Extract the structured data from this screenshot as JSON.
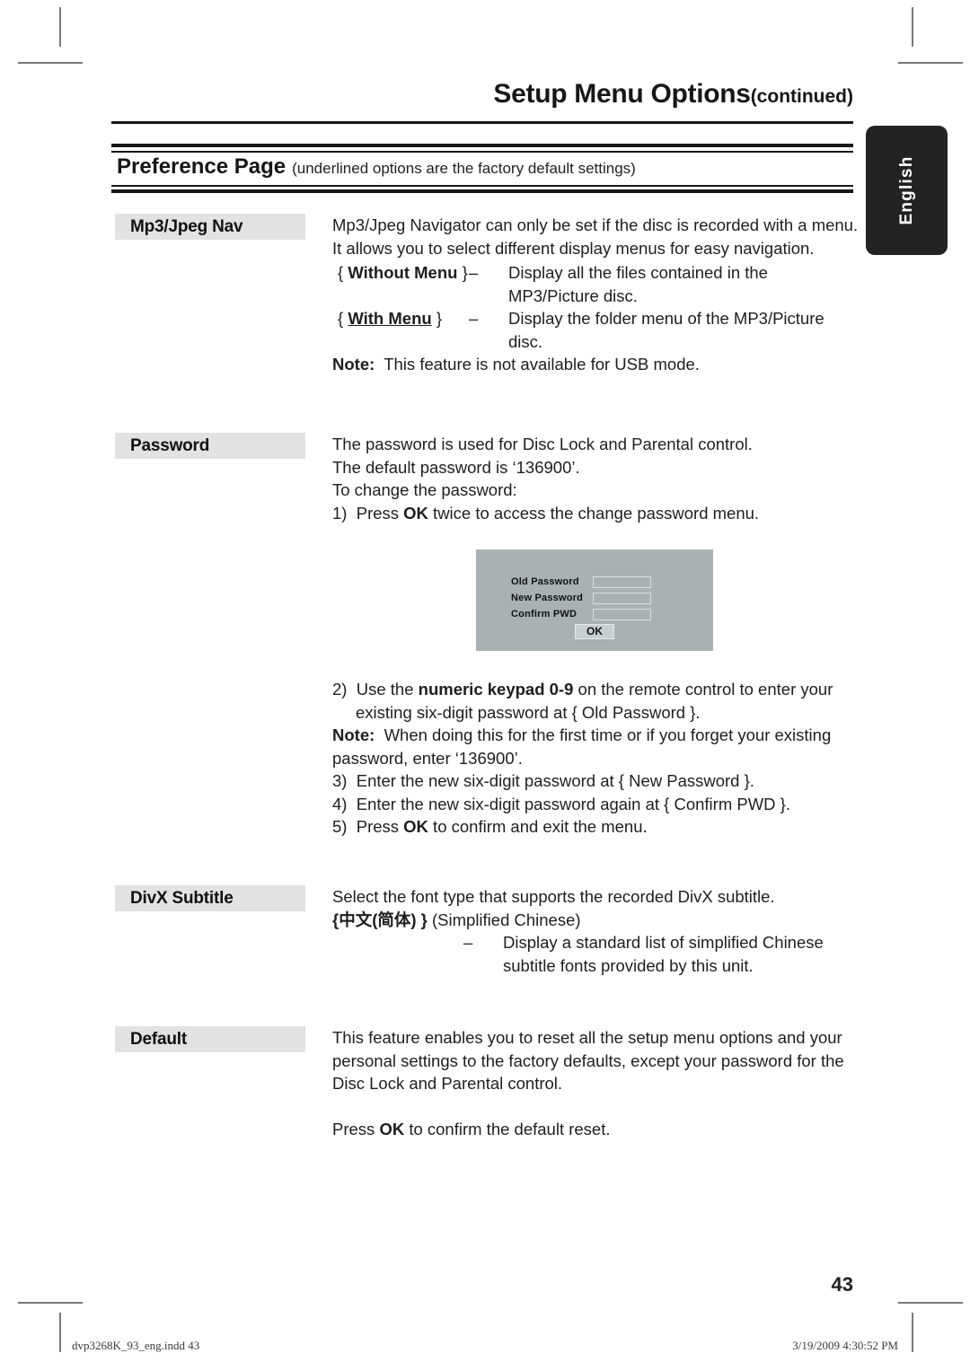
{
  "header": {
    "title": "Setup Menu Options",
    "continued": "(continued)"
  },
  "preference_bar": {
    "title": "Preference Page",
    "subtitle": "(underlined options are the factory default settings)"
  },
  "language_tab": {
    "label": "English"
  },
  "sections": {
    "mp3_jpeg_nav": {
      "label": "Mp3/Jpeg Nav",
      "intro": "Mp3/Jpeg Navigator can only be set if the disc is recorded with a menu. It allows you to select different display menus for easy navigation.",
      "options": [
        {
          "open_brace": "{",
          "name": "Without Menu",
          "close_brace": "}",
          "underlined": false,
          "dash": "–",
          "description": "Display all the files contained in the MP3/Picture disc."
        },
        {
          "open_brace": "{",
          "name": "With Menu",
          "close_brace": "}",
          "underlined": true,
          "dash": "–",
          "description": "Display the folder menu of the MP3/Picture disc."
        }
      ],
      "note_label": "Note:",
      "note_text": "This feature is not available for USB mode."
    },
    "password": {
      "label": "Password",
      "line1": "The password is used for Disc Lock and Parental control.",
      "line2": "The default password is ‘136900’.",
      "line3": "To change the password:",
      "step1_number": "1)",
      "step1_pre": "Press ",
      "step1_bold": "OK",
      "step1_post": " twice to access the change password menu.",
      "osd": {
        "old_password_label": "Old  Password",
        "new_password_label": "New Password",
        "confirm_pwd_label": "Confirm PWD",
        "old_password_value": "",
        "new_password_value": "",
        "confirm_pwd_value": "",
        "ok_button": "OK",
        "background_color": "#a8b2b4",
        "field_border_color": "#d8dde0"
      },
      "step2_number": "2)",
      "step2_pre": "Use the ",
      "step2_bold": "numeric keypad 0-9",
      "step2_post": " on the remote control to enter your existing six-digit password at { Old Password }.",
      "note_label": "Note:",
      "note_text": "When doing this for the first time or if you forget your existing password, enter ‘136900’.",
      "step3_number": "3)",
      "step3_text": "Enter the new six-digit password at { New Password }.",
      "step4_number": "4)",
      "step4_text": "Enter the new six-digit password again at { Confirm PWD }.",
      "step5_number": "5)",
      "step5_pre": "Press ",
      "step5_bold": "OK",
      "step5_post": " to confirm and exit the menu."
    },
    "divx_subtitle": {
      "label": "DivX Subtitle",
      "line1": "Select the font type that supports the recorded DivX subtitle.",
      "option_key": "{中文(简体) }",
      "option_caption": "(Simplified Chinese)",
      "dash": "–",
      "option_description": "Display a standard list of simplified Chinese subtitle fonts provided by this unit."
    },
    "default": {
      "label": "Default",
      "line1": "This feature enables you to reset all the setup menu options and your personal settings to the factory defaults, except your password for the Disc Lock and Parental control.",
      "line2_pre": "Press ",
      "line2_bold": "OK",
      "line2_post": " to confirm the default reset."
    }
  },
  "page_number": "43",
  "footer": {
    "file_name": "dvp3268K_93_eng.indd   43",
    "timestamp": "3/19/2009   4:30:52 PM"
  }
}
